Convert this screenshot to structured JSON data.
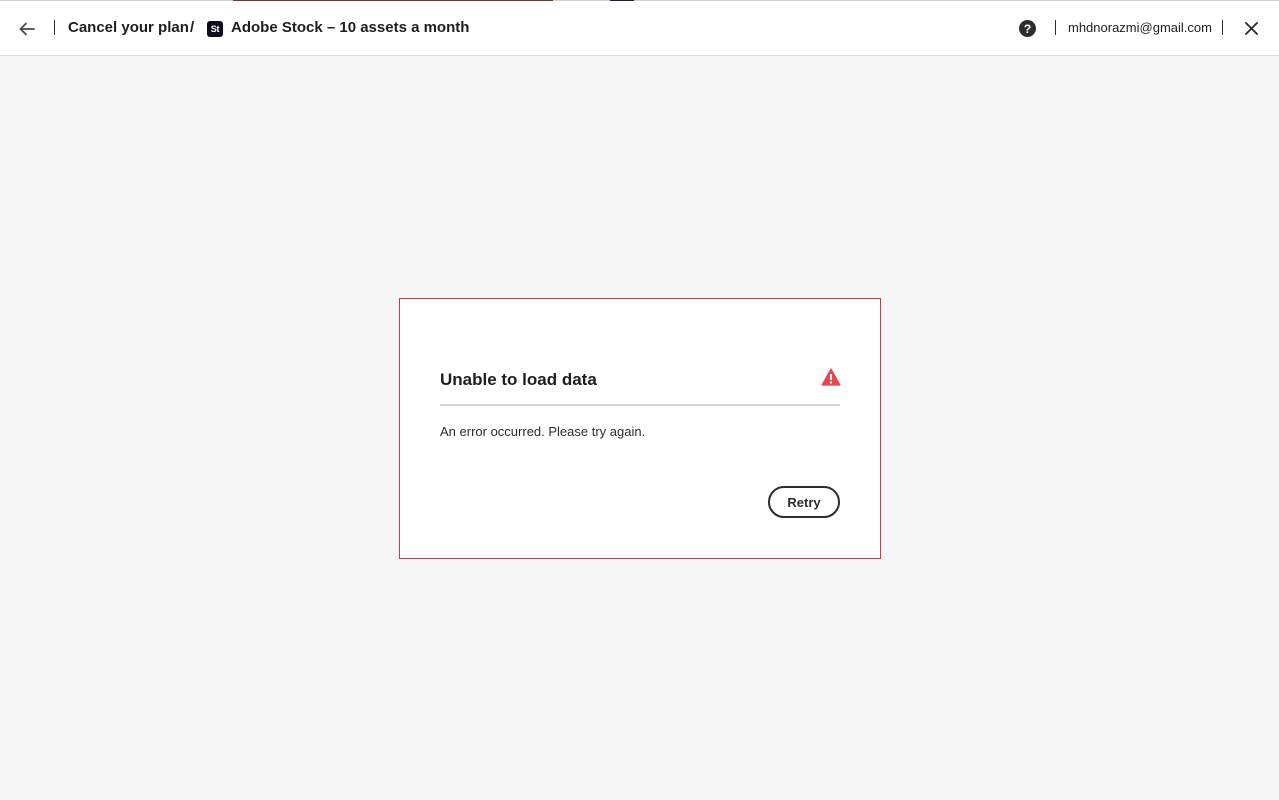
{
  "header": {
    "back_icon": "arrow-left-icon",
    "title": "Cancel your plan",
    "separator": "/",
    "product_icon_label": "St",
    "product_name": "Adobe Stock – 10 assets a month",
    "help_icon": "question-circle-icon",
    "help_glyph": "?",
    "user_email": "mhdnorazmi@gmail.com",
    "close_icon": "close-icon"
  },
  "error_card": {
    "title": "Unable to load data",
    "alert_icon": "alert-triangle-icon",
    "message": "An error occurred. Please try again.",
    "retry_label": "Retry",
    "border_color": "#d7373f",
    "alert_color": "#e34850"
  },
  "colors": {
    "background": "#f6f6f6",
    "header_background": "#ffffff",
    "text": "#1e1e1e"
  }
}
